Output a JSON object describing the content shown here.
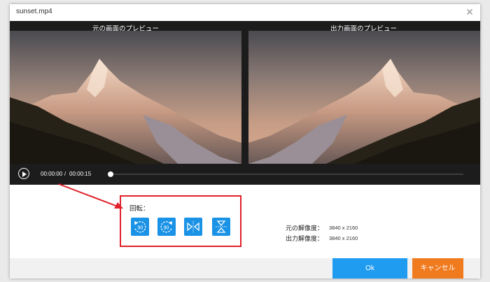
{
  "window": {
    "title": "sunset.mp4"
  },
  "preview": {
    "original_label": "元の画面のプレビュー",
    "output_label": "出力画面のプレビュー"
  },
  "playback": {
    "current_time": "00:00:00",
    "separator": "/",
    "total_time": "00:00:15",
    "progress": 0
  },
  "rotation": {
    "label": "回転：",
    "buttons": [
      {
        "name": "rotate-left-90",
        "text": "90",
        "icon": "rotate-counterclockwise-icon"
      },
      {
        "name": "rotate-right-90",
        "text": "90",
        "icon": "rotate-clockwise-icon"
      },
      {
        "name": "flip-horizontal",
        "icon": "flip-horizontal-icon"
      },
      {
        "name": "flip-vertical",
        "icon": "flip-vertical-icon"
      }
    ]
  },
  "resolution": {
    "original_label": "元の解像度：",
    "original_value": "3840 x 2160",
    "output_label": "出力解像度：",
    "output_value": "3840 x 2160"
  },
  "footer": {
    "ok_label": "Ok",
    "cancel_label": "キャンセル"
  },
  "colors": {
    "accent_blue": "#1a92e6",
    "cancel_orange": "#f07a1e",
    "highlight_red": "#e0202a"
  }
}
